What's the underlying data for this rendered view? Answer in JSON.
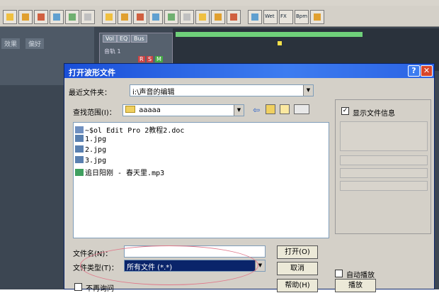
{
  "toolbar": {
    "icons": [
      "new-icon",
      "open-icon",
      "save-icon",
      "cut-icon",
      "copy-icon",
      "paste-icon",
      "loop-icon",
      "mixer-icon",
      "wave-icon",
      "envelope-icon",
      "noise-icon",
      "edit-icon",
      "effects-icon",
      "cd-icon",
      "record-icon",
      "play-icon",
      "wet-icon",
      "fx-icon",
      "bpm-icon",
      "zoom-icon"
    ],
    "labels": {
      "wet": "Wet",
      "fx": "FX",
      "bpm": "Bpm"
    }
  },
  "editor": {
    "tabs": [
      "效果",
      "偏好"
    ],
    "vol_buttons": [
      "Vol",
      "EQ",
      "Bus"
    ],
    "track_label": "音轨 1",
    "track_buttons": [
      "R",
      "S",
      "M"
    ]
  },
  "dialog": {
    "title": "打开波形文件",
    "recent_label": "最近文件夹：",
    "recent_value": "i:\\声音的编辑",
    "lookin_label": "查找范围(I)：",
    "lookin_value": "aaaaa",
    "files": [
      {
        "icon": "doc",
        "name": "~$ol Edit Pro 2教程2.doc"
      },
      {
        "icon": "jpg",
        "name": "1.jpg"
      },
      {
        "icon": "jpg",
        "name": "2.jpg"
      },
      {
        "icon": "jpg",
        "name": "3.jpg"
      },
      {
        "icon": "mp3",
        "name": "追日阳刚 - 春天里.mp3"
      }
    ],
    "show_info_label": "显示文件信息",
    "filename_label": "文件名(N)：",
    "filename_value": "",
    "filetype_label": "文件类型(T)：",
    "filetype_value": "所有文件  (*.*)",
    "open_button": "打开(O)",
    "cancel_button": "取消",
    "help_button": "帮助(H)",
    "no_prompt_label": "不再询问",
    "autoplay_label": "自动播放",
    "play_button": "播放",
    "help_title_btn": "?",
    "close_title_btn": "✕"
  },
  "colors": {
    "title_bar": "#1a4fd8",
    "highlight": "#0a246a",
    "annotation": "#e0788a",
    "track": "#6fd07a"
  }
}
